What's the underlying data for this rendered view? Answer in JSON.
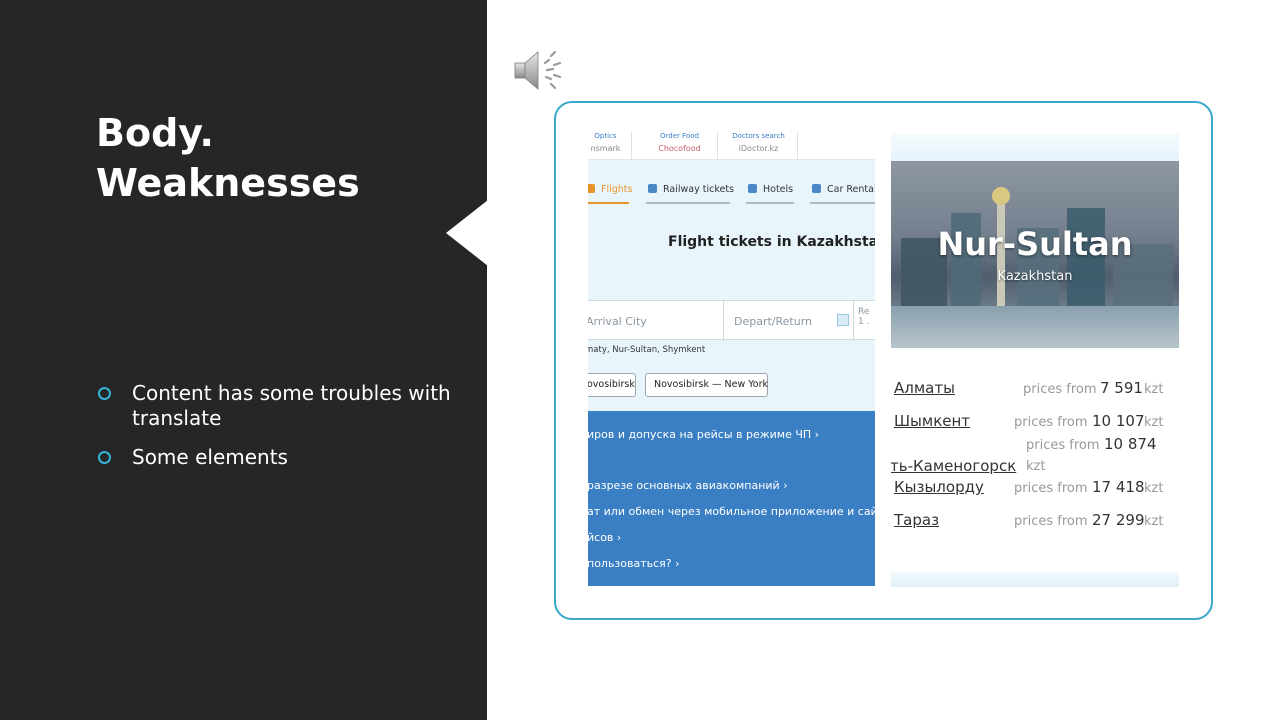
{
  "slide": {
    "title_line1": "Body.",
    "title_line2": "Weaknesses",
    "bullets": [
      "Content has some troubles with translate",
      "Some elements"
    ]
  },
  "screenshot_left": {
    "partners": [
      {
        "label": "Optics",
        "brand": "nsmark"
      },
      {
        "label": "Order Food",
        "brand": "Chocofood"
      },
      {
        "label": "Doctors search",
        "brand": "iDoctor.kz"
      }
    ],
    "tabs": [
      {
        "label": "Flights",
        "icon": "plane-icon"
      },
      {
        "label": "Railway tickets",
        "icon": "train-icon"
      },
      {
        "label": "Hotels",
        "icon": "hotel-icon"
      },
      {
        "label": "Car Rental",
        "icon": "car-icon"
      }
    ],
    "hero_title": "Flight tickets in Kazakhstan",
    "fields": {
      "arrival_placeholder": "Arrival City",
      "depart_placeholder": "Depart/Return",
      "extra_label_1": "Re",
      "extra_label_2": "1 ."
    },
    "popular_cities": "maty, Nur-Sultan, Shymkent",
    "chips": [
      "ovosibirsk",
      "Novosibirsk — New York"
    ],
    "blue_links": [
      "иров и допуска на рейсы в режиме ЧП ›",
      "разрезе основных авиакомпаний ›",
      "ат или обмен через мобильное приложение и сайт?",
      "йсов ›",
      "пользоваться? ›"
    ]
  },
  "screenshot_right": {
    "city_name": "Nur-Sultan",
    "country": "Kazakhstan",
    "destinations": [
      {
        "city": "Алматы",
        "prefix": "prices from",
        "price": "7 591",
        "currency": "kzt"
      },
      {
        "city": "Шымкент",
        "prefix": "prices from",
        "price": "10 107",
        "currency": "kzt"
      },
      {
        "city": "ть-Каменогорск",
        "prefix": "prices from",
        "price": "10 874",
        "currency": "kzt"
      },
      {
        "city": "Кызылорду",
        "prefix": "prices from",
        "price": "17 418",
        "currency": "kzt"
      },
      {
        "city": "Тараз",
        "prefix": "prices from",
        "price": "27 299",
        "currency": "kzt"
      }
    ]
  },
  "icons": {
    "audio": "speaker-icon"
  },
  "colors": {
    "dark_panel": "#262626",
    "accent": "#3aa8c9",
    "bullet": "#33b4d6",
    "blue_section": "#3a7fc4",
    "active_tab": "#e8922a"
  }
}
